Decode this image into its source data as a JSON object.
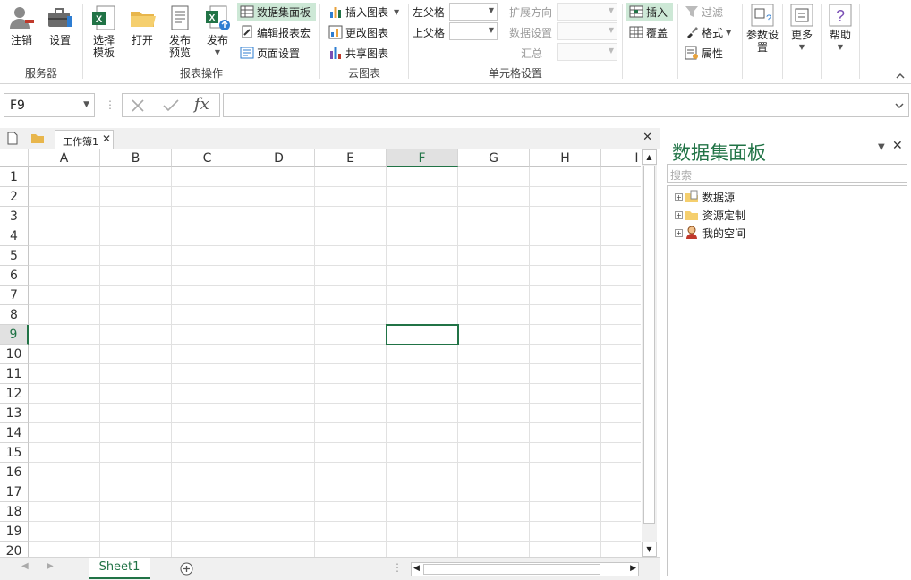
{
  "ribbon": {
    "groups": {
      "server": {
        "label": "服务器",
        "logout": "注销",
        "settings": "设置"
      },
      "report_ops": {
        "label": "报表操作",
        "select_template": "选择\n模板",
        "open": "打开",
        "publish_preview": "发布\n预览",
        "publish": "发布",
        "data_panel": "数据集面板",
        "edit_macro": "编辑报表宏",
        "page_setup": "页面设置"
      },
      "cloud_chart": {
        "label": "云图表",
        "insert_chart": "插入图表",
        "change_chart": "更改图表",
        "share_chart": "共享图表"
      },
      "cell_settings": {
        "label": "单元格设置",
        "left_parent": "左父格",
        "top_parent": "上父格",
        "expand_dir": "扩展方向",
        "data_setting": "数据设置",
        "summary": "汇总",
        "insert": "插入",
        "overwrite": "覆盖",
        "filter": "过滤",
        "format": "格式",
        "properties": "属性"
      },
      "misc": {
        "param_settings": "参数设\n置",
        "more": "更多",
        "help": "帮助"
      }
    }
  },
  "formula_bar": {
    "name_box": "F9",
    "formula": ""
  },
  "workbook": {
    "tab_name": "工作簿1"
  },
  "grid": {
    "columns": [
      "A",
      "B",
      "C",
      "D",
      "E",
      "F",
      "G",
      "H",
      "I"
    ],
    "rows": [
      "1",
      "2",
      "3",
      "4",
      "5",
      "6",
      "7",
      "8",
      "9",
      "10",
      "11",
      "12",
      "13",
      "14",
      "15",
      "16",
      "17",
      "18",
      "19",
      "20"
    ],
    "selected": "F9"
  },
  "sheets": [
    {
      "name": "Sheet1"
    }
  ],
  "panel": {
    "title": "数据集面板",
    "search_placeholder": "搜索",
    "tree": [
      {
        "label": "数据源"
      },
      {
        "label": "资源定制"
      },
      {
        "label": "我的空间"
      }
    ]
  },
  "colors": {
    "accent": "#217346",
    "active_btn_bg": "#cde8d6"
  }
}
